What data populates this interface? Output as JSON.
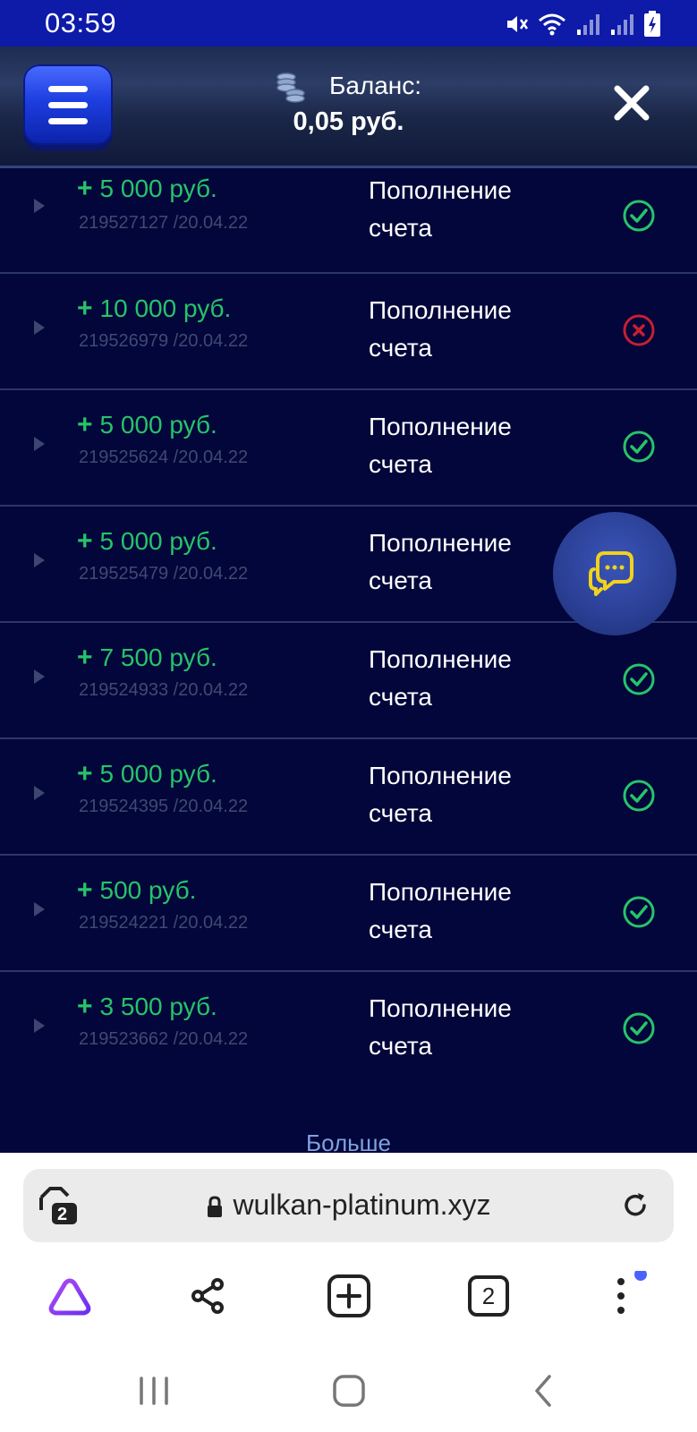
{
  "status_bar": {
    "time": "03:59"
  },
  "header": {
    "balance_label": "Баланс:",
    "balance_value": "0,05 руб."
  },
  "transactions": [
    {
      "amount": "5 000 руб.",
      "id": "219527127 /20.04.22",
      "description": "Пополнение счета",
      "status": "success"
    },
    {
      "amount": "10 000 руб.",
      "id": "219526979 /20.04.22",
      "description": "Пополнение счета",
      "status": "failed"
    },
    {
      "amount": "5 000 руб.",
      "id": "219525624 /20.04.22",
      "description": "Пополнение счета",
      "status": "success"
    },
    {
      "amount": "5 000 руб.",
      "id": "219525479 /20.04.22",
      "description": "Пополнение счета",
      "status": "success"
    },
    {
      "amount": "7 500 руб.",
      "id": "219524933 /20.04.22",
      "description": "Пополнение счета",
      "status": "success"
    },
    {
      "amount": "5 000 руб.",
      "id": "219524395 /20.04.22",
      "description": "Пополнение счета",
      "status": "success"
    },
    {
      "amount": "500 руб.",
      "id": "219524221 /20.04.22",
      "description": "Пополнение счета",
      "status": "success"
    },
    {
      "amount": "3 500 руб.",
      "id": "219523662 /20.04.22",
      "description": "Пополнение счета",
      "status": "success"
    }
  ],
  "more_label": "Больше",
  "browser": {
    "url": "wulkan-platinum.xyz",
    "tab_group_count": "2",
    "tabs_count": "2"
  },
  "colors": {
    "accent_green": "#27c36a",
    "error_red": "#c81e32",
    "status_bar_blue": "#0e1aa8",
    "background": "#02063a"
  }
}
